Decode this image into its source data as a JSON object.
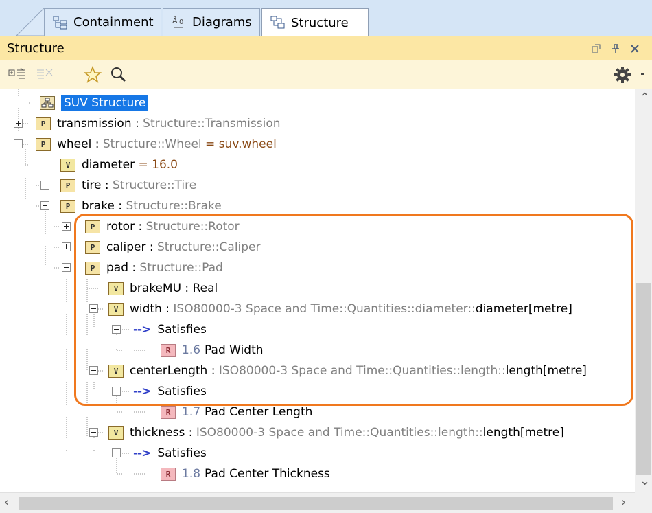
{
  "tabs": [
    {
      "label": "Containment",
      "icon": "containment-icon"
    },
    {
      "label": "Diagrams",
      "icon": "diagrams-icon"
    },
    {
      "label": "Structure",
      "icon": "structure-icon",
      "active": true
    }
  ],
  "panel": {
    "title": "Structure",
    "buttons": [
      "restore-icon",
      "pin-icon",
      "close-icon"
    ]
  },
  "toolbar": {
    "buttons": [
      "expand-all-icon",
      "collapse-all-icon",
      "favorites-star-icon",
      "search-icon",
      "settings-gear-icon"
    ]
  },
  "tree": {
    "rows": [
      {
        "name": "SUV Structure",
        "selected": true
      },
      {
        "name": "transmission",
        "sep": " : ",
        "type": "Structure::Transmission"
      },
      {
        "name": "wheel",
        "sep": " : ",
        "type": "Structure::Wheel",
        "value": " = suv.wheel"
      },
      {
        "name": "diameter",
        "value": " = 16.0"
      },
      {
        "name": "tire",
        "sep": " : ",
        "type": "Structure::Tire"
      },
      {
        "name": "brake",
        "sep": " : ",
        "type": "Structure::Brake"
      },
      {
        "name": "rotor",
        "sep": " : ",
        "type": "Structure::Rotor"
      },
      {
        "name": "caliper",
        "sep": " : ",
        "type": "Structure::Caliper"
      },
      {
        "name": "pad",
        "sep": " : ",
        "type": "Structure::Pad"
      },
      {
        "name": "brakeMU",
        "sep": " : ",
        "type2": "Real"
      },
      {
        "name": "width",
        "sep": " : ",
        "type": "ISO80000-3 Space and Time::Quantities::diameter::",
        "type2": "diameter[metre]"
      },
      {
        "label": "Satisfies",
        "arrow": "-->"
      },
      {
        "num": "1.6",
        "name": "Pad Width"
      },
      {
        "name": "centerLength",
        "sep": " : ",
        "type": "ISO80000-3 Space and Time::Quantities::length::",
        "type2": "length[metre]"
      },
      {
        "label": "Satisfies",
        "arrow": "-->"
      },
      {
        "num": "1.7",
        "name": "Pad Center Length"
      },
      {
        "name": "thickness",
        "sep": " : ",
        "type": "ISO80000-3 Space and Time::Quantities::length::",
        "type2": "length[metre]"
      },
      {
        "label": "Satisfies",
        "arrow": "-->"
      },
      {
        "num": "1.8",
        "name": "Pad Center Thickness"
      }
    ]
  },
  "badges": {
    "part": "P",
    "value": "V",
    "requirement": "R"
  },
  "colors": {
    "highlight": "#f0781e",
    "selection": "#1677e6",
    "header": "#fce7a4"
  }
}
